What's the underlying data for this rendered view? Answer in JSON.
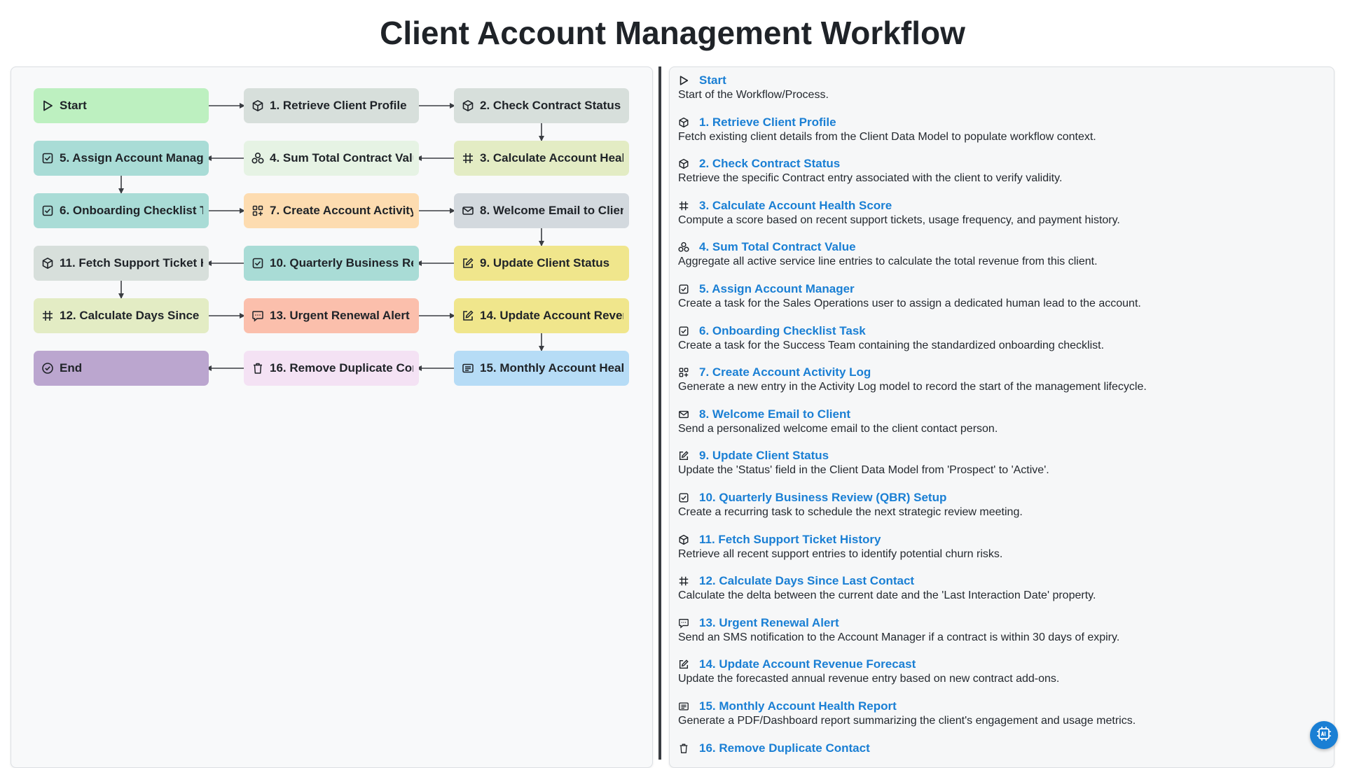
{
  "title": "Client Account Management Workflow",
  "colors": {
    "accent": "#1a7fd4",
    "start": "#bdf0c0",
    "grayblue": "#d7dfdb",
    "teal": "#a9dcd6",
    "lightgreen": "#e6f3e4",
    "yellowgreen": "#e3ecc4",
    "peach": "#fddcb0",
    "gray": "#d3d9de",
    "yellow": "#f0e68c",
    "salmon": "#fbbfac",
    "blue": "#b6dcf6",
    "pink": "#f4e2f4",
    "purple": "#bba6cf"
  },
  "nodes": [
    {
      "label": "Start",
      "icon": "play-icon"
    },
    {
      "label": "1. Retrieve Client Profile",
      "icon": "cube-icon"
    },
    {
      "label": "2. Check Contract Status",
      "icon": "cube-icon"
    },
    {
      "label": "3. Calculate Account Health Score",
      "icon": "hash-icon"
    },
    {
      "label": "4. Sum Total Contract Value",
      "icon": "aggregate-icon"
    },
    {
      "label": "5. Assign Account Manager",
      "icon": "checkbox-icon"
    },
    {
      "label": "6. Onboarding Checklist Task",
      "icon": "checkbox-icon"
    },
    {
      "label": "7. Create Account Activity Log",
      "icon": "grid-plus-icon"
    },
    {
      "label": "8. Welcome Email to Client",
      "icon": "mail-icon"
    },
    {
      "label": "9. Update Client Status",
      "icon": "edit-icon"
    },
    {
      "label": "10. Quarterly Business Review (QBR) Setup",
      "icon": "checkbox-icon"
    },
    {
      "label": "11. Fetch Support Ticket History",
      "icon": "cube-icon"
    },
    {
      "label": "12. Calculate Days Since Last Contact",
      "icon": "hash-icon"
    },
    {
      "label": "13. Urgent Renewal Alert",
      "icon": "sms-icon"
    },
    {
      "label": "14. Update Account Revenue Forecast",
      "icon": "edit-icon"
    },
    {
      "label": "15. Monthly Account Health Report",
      "icon": "report-icon"
    },
    {
      "label": "16. Remove Duplicate Contact",
      "icon": "trash-icon"
    },
    {
      "label": "End",
      "icon": "check-circle-icon"
    }
  ],
  "steps": [
    {
      "title": "Start",
      "desc": "Start of the Workflow/Process.",
      "icon": "play-icon"
    },
    {
      "title": "1. Retrieve Client Profile",
      "desc": "Fetch existing client details from the Client Data Model to populate workflow context.",
      "icon": "cube-icon"
    },
    {
      "title": "2. Check Contract Status",
      "desc": "Retrieve the specific Contract entry associated with the client to verify validity.",
      "icon": "cube-icon"
    },
    {
      "title": "3. Calculate Account Health Score",
      "desc": "Compute a score based on recent support tickets, usage frequency, and payment history.",
      "icon": "hash-icon"
    },
    {
      "title": "4. Sum Total Contract Value",
      "desc": "Aggregate all active service line entries to calculate the total revenue from this client.",
      "icon": "aggregate-icon"
    },
    {
      "title": "5. Assign Account Manager",
      "desc": "Create a task for the Sales Operations user to assign a dedicated human lead to the account.",
      "icon": "checkbox-icon"
    },
    {
      "title": "6. Onboarding Checklist Task",
      "desc": "Create a task for the Success Team containing the standardized onboarding checklist.",
      "icon": "checkbox-icon"
    },
    {
      "title": "7. Create Account Activity Log",
      "desc": "Generate a new entry in the Activity Log model to record the start of the management lifecycle.",
      "icon": "grid-plus-icon"
    },
    {
      "title": "8. Welcome Email to Client",
      "desc": "Send a personalized welcome email to the client contact person.",
      "icon": "mail-icon"
    },
    {
      "title": "9. Update Client Status",
      "desc": "Update the 'Status' field in the Client Data Model from 'Prospect' to 'Active'.",
      "icon": "edit-icon"
    },
    {
      "title": "10. Quarterly Business Review (QBR) Setup",
      "desc": "Create a recurring task to schedule the next strategic review meeting.",
      "icon": "checkbox-icon"
    },
    {
      "title": "11. Fetch Support Ticket History",
      "desc": "Retrieve all recent support entries to identify potential churn risks.",
      "icon": "cube-icon"
    },
    {
      "title": "12. Calculate Days Since Last Contact",
      "desc": "Calculate the delta between the current date and the 'Last Interaction Date' property.",
      "icon": "hash-icon"
    },
    {
      "title": "13. Urgent Renewal Alert",
      "desc": "Send an SMS notification to the Account Manager if a contract is within 30 days of expiry.",
      "icon": "sms-icon"
    },
    {
      "title": "14. Update Account Revenue Forecast",
      "desc": "Update the forecasted annual revenue entry based on new contract add-ons.",
      "icon": "edit-icon"
    },
    {
      "title": "15. Monthly Account Health Report",
      "desc": "Generate a PDF/Dashboard report summarizing the client's engagement and usage metrics.",
      "icon": "report-icon"
    },
    {
      "title": "16. Remove Duplicate Contact",
      "desc": "",
      "icon": "trash-icon"
    }
  ],
  "fab": {
    "icon": "ai-chip-icon"
  }
}
